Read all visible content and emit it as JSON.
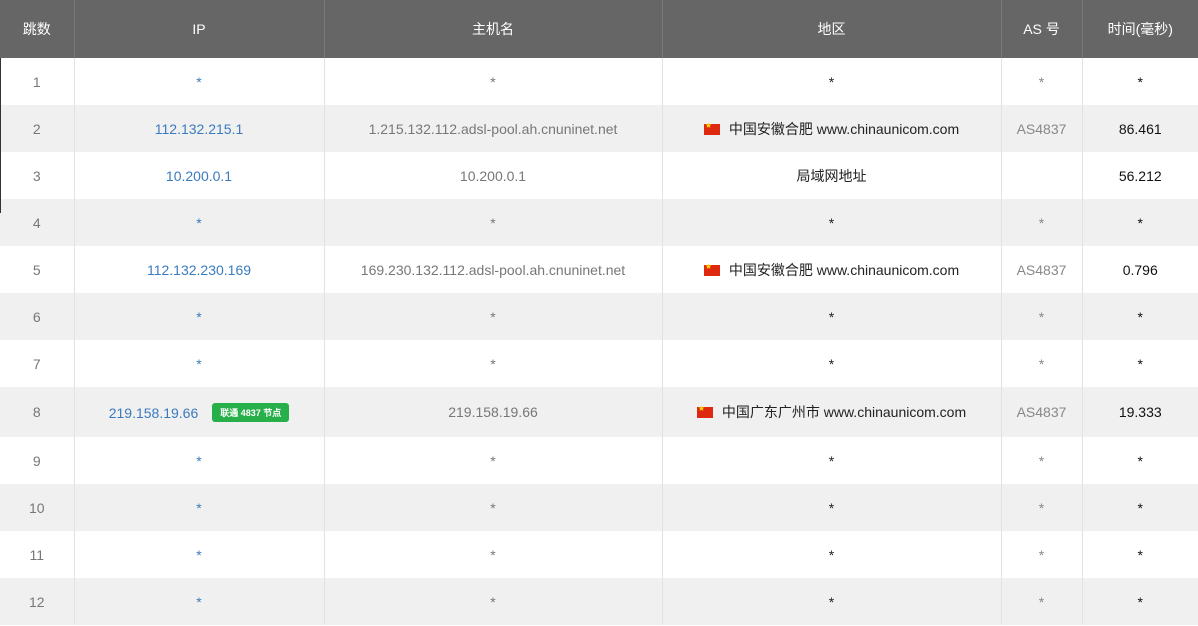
{
  "headers": {
    "hop": "跳数",
    "ip": "IP",
    "hostname": "主机名",
    "region": "地区",
    "asn": "AS 号",
    "time": "时间(毫秒)"
  },
  "flag_icon": "china-flag-icon",
  "rows": [
    {
      "hop": "1",
      "ip": "*",
      "hostname": "*",
      "region": "*",
      "flag": false,
      "asn": "*",
      "time": "*",
      "badge": ""
    },
    {
      "hop": "2",
      "ip": "112.132.215.1",
      "hostname": "1.215.132.112.adsl-pool.ah.cnuninet.net",
      "region": "中国安徽合肥 www.chinaunicom.com",
      "flag": true,
      "asn": "AS4837",
      "time": "86.461",
      "badge": ""
    },
    {
      "hop": "3",
      "ip": "10.200.0.1",
      "hostname": "10.200.0.1",
      "region": "局域网地址",
      "flag": false,
      "asn": "",
      "time": "56.212",
      "badge": ""
    },
    {
      "hop": "4",
      "ip": "*",
      "hostname": "*",
      "region": "*",
      "flag": false,
      "asn": "*",
      "time": "*",
      "badge": ""
    },
    {
      "hop": "5",
      "ip": "112.132.230.169",
      "hostname": "169.230.132.112.adsl-pool.ah.cnuninet.net",
      "region": "中国安徽合肥 www.chinaunicom.com",
      "flag": true,
      "asn": "AS4837",
      "time": "0.796",
      "badge": ""
    },
    {
      "hop": "6",
      "ip": "*",
      "hostname": "*",
      "region": "*",
      "flag": false,
      "asn": "*",
      "time": "*",
      "badge": ""
    },
    {
      "hop": "7",
      "ip": "*",
      "hostname": "*",
      "region": "*",
      "flag": false,
      "asn": "*",
      "time": "*",
      "badge": ""
    },
    {
      "hop": "8",
      "ip": "219.158.19.66",
      "hostname": "219.158.19.66",
      "region": "中国广东广州市 www.chinaunicom.com",
      "flag": true,
      "asn": "AS4837",
      "time": "19.333",
      "badge": "联通 4837 节点"
    },
    {
      "hop": "9",
      "ip": "*",
      "hostname": "*",
      "region": "*",
      "flag": false,
      "asn": "*",
      "time": "*",
      "badge": ""
    },
    {
      "hop": "10",
      "ip": "*",
      "hostname": "*",
      "region": "*",
      "flag": false,
      "asn": "*",
      "time": "*",
      "badge": ""
    },
    {
      "hop": "11",
      "ip": "*",
      "hostname": "*",
      "region": "*",
      "flag": false,
      "asn": "*",
      "time": "*",
      "badge": ""
    },
    {
      "hop": "12",
      "ip": "*",
      "hostname": "*",
      "region": "*",
      "flag": false,
      "asn": "*",
      "time": "*",
      "badge": ""
    }
  ]
}
